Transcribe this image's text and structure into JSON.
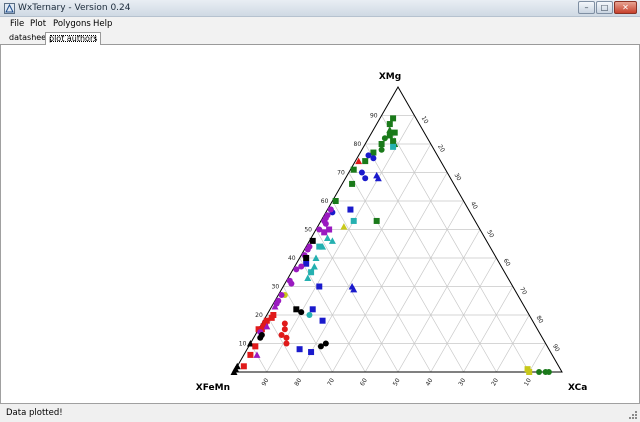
{
  "window": {
    "title": "WxTernary - Version 0.24"
  },
  "menu": {
    "items": [
      "File",
      "Plot",
      "Polygons",
      "Help"
    ]
  },
  "tabs": [
    {
      "label": "datasheet",
      "active": false
    },
    {
      "label": "plot authors",
      "active": true
    }
  ],
  "plot": {
    "vertex_labels": {
      "top": "XMg",
      "left": "XFeMn",
      "right": "XCa"
    },
    "left_ticks": [
      "10",
      "20",
      "30",
      "40",
      "50",
      "60",
      "70",
      "80",
      "90"
    ],
    "right_ticks": [
      "10",
      "20",
      "30",
      "40",
      "50",
      "60",
      "70",
      "80",
      "90"
    ],
    "bottom_ticks": [
      "90",
      "80",
      "70",
      "60",
      "50",
      "40",
      "30",
      "20",
      "10"
    ],
    "colors": {
      "green": "#1a7a1a",
      "blue": "#1a1acc",
      "purple": "#9a1ac0",
      "cyan": "#25b0b0",
      "red": "#e01a1a",
      "black": "#000000",
      "yellow": "#c8c81a",
      "grid": "#c8c8c8"
    },
    "points": [
      {
        "c": "green",
        "s": "square",
        "mg": 89,
        "ca": 4
      },
      {
        "c": "green",
        "s": "square",
        "mg": 87,
        "ca": 4
      },
      {
        "c": "green",
        "s": "triangle",
        "mg": 85,
        "ca": 5
      },
      {
        "c": "green",
        "s": "square",
        "mg": 84,
        "ca": 7
      },
      {
        "c": "green",
        "s": "square",
        "mg": 83,
        "ca": 6
      },
      {
        "c": "green",
        "s": "circle",
        "mg": 82,
        "ca": 5
      },
      {
        "c": "green",
        "s": "square",
        "mg": 81,
        "ca": 8
      },
      {
        "c": "green",
        "s": "triangle",
        "mg": 80,
        "ca": 9
      },
      {
        "c": "green",
        "s": "square",
        "mg": 80,
        "ca": 5
      },
      {
        "c": "cyan",
        "s": "square",
        "mg": 79,
        "ca": 9
      },
      {
        "c": "green",
        "s": "circle",
        "mg": 78,
        "ca": 6
      },
      {
        "c": "green",
        "s": "square",
        "mg": 77,
        "ca": 4
      },
      {
        "c": "blue",
        "s": "circle",
        "mg": 76,
        "ca": 3
      },
      {
        "c": "blue",
        "s": "circle",
        "mg": 75,
        "ca": 5
      },
      {
        "c": "red",
        "s": "triangle",
        "mg": 74,
        "ca": 1
      },
      {
        "c": "green",
        "s": "square",
        "mg": 74,
        "ca": 3
      },
      {
        "c": "green",
        "s": "square",
        "mg": 71,
        "ca": 1
      },
      {
        "c": "blue",
        "s": "circle",
        "mg": 70,
        "ca": 4
      },
      {
        "c": "blue",
        "s": "triangle",
        "mg": 69,
        "ca": 9
      },
      {
        "c": "blue",
        "s": "triangle",
        "mg": 68,
        "ca": 10
      },
      {
        "c": "blue",
        "s": "circle",
        "mg": 68,
        "ca": 6
      },
      {
        "c": "green",
        "s": "square",
        "mg": 66,
        "ca": 3
      },
      {
        "c": "green",
        "s": "square",
        "mg": 60,
        "ca": 1
      },
      {
        "c": "green",
        "s": "square",
        "mg": 53,
        "ca": 17
      },
      {
        "c": "yellow",
        "s": "triangle",
        "mg": 51,
        "ca": 8
      },
      {
        "c": "blue",
        "s": "square",
        "mg": 57,
        "ca": 7
      },
      {
        "c": "cyan",
        "s": "square",
        "mg": 53,
        "ca": 10
      },
      {
        "c": "blue",
        "s": "circle",
        "mg": 57,
        "ca": 1
      },
      {
        "c": "blue",
        "s": "circle",
        "mg": 56,
        "ca": 2
      },
      {
        "c": "purple",
        "s": "circle",
        "mg": 57,
        "ca": 1
      },
      {
        "c": "purple",
        "s": "circle",
        "mg": 55,
        "ca": 1
      },
      {
        "c": "purple",
        "s": "circle",
        "mg": 54,
        "ca": 1
      },
      {
        "c": "purple",
        "s": "circle",
        "mg": 53,
        "ca": 1
      },
      {
        "c": "purple",
        "s": "circle",
        "mg": 52,
        "ca": 2
      },
      {
        "c": "purple",
        "s": "circle",
        "mg": 50,
        "ca": 1
      },
      {
        "c": "purple",
        "s": "square",
        "mg": 50,
        "ca": 4
      },
      {
        "c": "purple",
        "s": "square",
        "mg": 49,
        "ca": 3
      },
      {
        "c": "cyan",
        "s": "triangle",
        "mg": 47,
        "ca": 5
      },
      {
        "c": "cyan",
        "s": "triangle",
        "mg": 46,
        "ca": 7
      },
      {
        "c": "black",
        "s": "square",
        "mg": 46,
        "ca": 1
      },
      {
        "c": "cyan",
        "s": "triangle",
        "mg": 44,
        "ca": 5
      },
      {
        "c": "cyan",
        "s": "square",
        "mg": 44,
        "ca": 4
      },
      {
        "c": "purple",
        "s": "circle",
        "mg": 44,
        "ca": 1
      },
      {
        "c": "purple",
        "s": "circle",
        "mg": 43,
        "ca": 1
      },
      {
        "c": "purple",
        "s": "circle",
        "mg": 41,
        "ca": 1
      },
      {
        "c": "cyan",
        "s": "triangle",
        "mg": 40,
        "ca": 5
      },
      {
        "c": "blue",
        "s": "square",
        "mg": 38,
        "ca": 3
      },
      {
        "c": "purple",
        "s": "circle",
        "mg": 37,
        "ca": 2
      },
      {
        "c": "cyan",
        "s": "triangle",
        "mg": 37,
        "ca": 6
      },
      {
        "c": "cyan",
        "s": "square",
        "mg": 35,
        "ca": 6
      },
      {
        "c": "black",
        "s": "square",
        "mg": 40,
        "ca": 2
      },
      {
        "c": "purple",
        "s": "circle",
        "mg": 36,
        "ca": 1
      },
      {
        "c": "cyan",
        "s": "triangle",
        "mg": 33,
        "ca": 6
      },
      {
        "c": "purple",
        "s": "circle",
        "mg": 32,
        "ca": 1
      },
      {
        "c": "purple",
        "s": "circle",
        "mg": 31,
        "ca": 2
      },
      {
        "c": "blue",
        "s": "square",
        "mg": 30,
        "ca": 11
      },
      {
        "c": "blue",
        "s": "triangle",
        "mg": 30,
        "ca": 21
      },
      {
        "c": "blue",
        "s": "triangle",
        "mg": 29,
        "ca": 22
      },
      {
        "c": "yellow",
        "s": "circle",
        "mg": 27,
        "ca": 2
      },
      {
        "c": "purple",
        "s": "circle",
        "mg": 27,
        "ca": 1
      },
      {
        "c": "purple",
        "s": "circle",
        "mg": 25,
        "ca": 1
      },
      {
        "c": "purple",
        "s": "circle",
        "mg": 24,
        "ca": 1
      },
      {
        "c": "purple",
        "s": "triangle",
        "mg": 23,
        "ca": 1
      },
      {
        "c": "blue",
        "s": "square",
        "mg": 22,
        "ca": 13
      },
      {
        "c": "red",
        "s": "square",
        "mg": 20,
        "ca": 2
      },
      {
        "c": "black",
        "s": "square",
        "mg": 22,
        "ca": 8
      },
      {
        "c": "cyan",
        "s": "circle",
        "mg": 20,
        "ca": 13
      },
      {
        "c": "black",
        "s": "circle",
        "mg": 21,
        "ca": 10
      },
      {
        "c": "red",
        "s": "square",
        "mg": 19,
        "ca": 2
      },
      {
        "c": "red",
        "s": "square",
        "mg": 18,
        "ca": 1
      },
      {
        "c": "red",
        "s": "square",
        "mg": 17,
        "ca": 1
      },
      {
        "c": "red",
        "s": "square",
        "mg": 16,
        "ca": 1
      },
      {
        "c": "red",
        "s": "square",
        "mg": 15,
        "ca": 1
      },
      {
        "c": "red",
        "s": "square",
        "mg": 15,
        "ca": 0
      },
      {
        "c": "red",
        "s": "circle",
        "mg": 17,
        "ca": 7
      },
      {
        "c": "red",
        "s": "circle",
        "mg": 15,
        "ca": 8
      },
      {
        "c": "red",
        "s": "circle",
        "mg": 13,
        "ca": 8
      },
      {
        "c": "blue",
        "s": "square",
        "mg": 18,
        "ca": 18
      },
      {
        "c": "red",
        "s": "circle",
        "mg": 12,
        "ca": 10
      },
      {
        "c": "red",
        "s": "circle",
        "mg": 10,
        "ca": 11
      },
      {
        "c": "purple",
        "s": "triangle",
        "mg": 16,
        "ca": 2
      },
      {
        "c": "purple",
        "s": "circle",
        "mg": 14,
        "ca": 1
      },
      {
        "c": "black",
        "s": "circle",
        "mg": 13,
        "ca": 2
      },
      {
        "c": "black",
        "s": "circle",
        "mg": 12,
        "ca": 2
      },
      {
        "c": "black",
        "s": "triangle",
        "mg": 10,
        "ca": 0
      },
      {
        "c": "purple",
        "s": "triangle",
        "mg": 6,
        "ca": 4
      },
      {
        "c": "red",
        "s": "square",
        "mg": 9,
        "ca": 2
      },
      {
        "c": "red",
        "s": "square",
        "mg": 6,
        "ca": 2
      },
      {
        "c": "red",
        "s": "square",
        "mg": 2,
        "ca": 2
      },
      {
        "c": "blue",
        "s": "square",
        "mg": 8,
        "ca": 16
      },
      {
        "c": "black",
        "s": "circle",
        "mg": 9,
        "ca": 22
      },
      {
        "c": "black",
        "s": "circle",
        "mg": 10,
        "ca": 23
      },
      {
        "c": "blue",
        "s": "square",
        "mg": 7,
        "ca": 20
      },
      {
        "c": "black",
        "s": "triangle",
        "mg": 1,
        "ca": 0
      },
      {
        "c": "black",
        "s": "triangle",
        "mg": 2,
        "ca": 0
      },
      {
        "c": "black",
        "s": "triangle",
        "mg": 0,
        "ca": 0
      },
      {
        "c": "yellow",
        "s": "square",
        "mg": 1,
        "ca": 89
      },
      {
        "c": "yellow",
        "s": "square",
        "mg": 0,
        "ca": 90
      },
      {
        "c": "green",
        "s": "circle",
        "mg": 0,
        "ca": 93
      },
      {
        "c": "green",
        "s": "circle",
        "mg": 0,
        "ca": 95
      },
      {
        "c": "green",
        "s": "circle",
        "mg": 0,
        "ca": 96
      }
    ]
  },
  "status": {
    "text": "Data plotted!"
  }
}
